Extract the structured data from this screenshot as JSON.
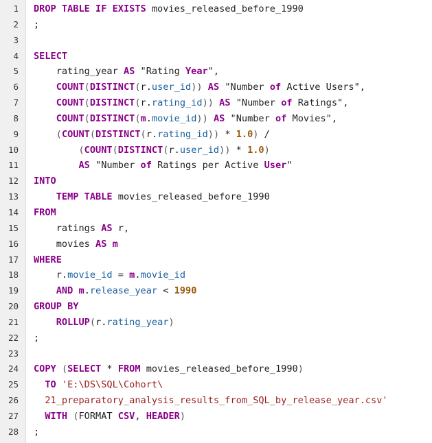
{
  "editor": {
    "lines": [
      [
        {
          "t": "k",
          "v": "DROP TABLE IF EXISTS"
        },
        {
          "t": "s",
          "v": " movies_released_before_1990"
        }
      ],
      [
        {
          "t": "s",
          "v": ";"
        }
      ],
      [],
      [
        {
          "t": "k",
          "v": "SELECT"
        }
      ],
      [
        {
          "t": "s",
          "v": "    rating_year "
        },
        {
          "t": "k",
          "v": "AS"
        },
        {
          "t": "s",
          "v": " \"Rating "
        },
        {
          "t": "k",
          "v": "Year"
        },
        {
          "t": "s",
          "v": "\","
        }
      ],
      [
        {
          "t": "s",
          "v": "    "
        },
        {
          "t": "k",
          "v": "COUNT"
        },
        {
          "t": "p",
          "v": "("
        },
        {
          "t": "k",
          "v": "DISTINCT"
        },
        {
          "t": "p",
          "v": "("
        },
        {
          "t": "s",
          "v": "r."
        },
        {
          "t": "id",
          "v": "user_id"
        },
        {
          "t": "p",
          "v": "))"
        },
        {
          "t": "s",
          "v": " "
        },
        {
          "t": "k",
          "v": "AS"
        },
        {
          "t": "s",
          "v": " \"Number "
        },
        {
          "t": "k",
          "v": "of"
        },
        {
          "t": "s",
          "v": " Active Users\","
        }
      ],
      [
        {
          "t": "s",
          "v": "    "
        },
        {
          "t": "k",
          "v": "COUNT"
        },
        {
          "t": "p",
          "v": "("
        },
        {
          "t": "k",
          "v": "DISTINCT"
        },
        {
          "t": "p",
          "v": "("
        },
        {
          "t": "s",
          "v": "r."
        },
        {
          "t": "id",
          "v": "rating_id"
        },
        {
          "t": "p",
          "v": "))"
        },
        {
          "t": "s",
          "v": " "
        },
        {
          "t": "k",
          "v": "AS"
        },
        {
          "t": "s",
          "v": " \"Number "
        },
        {
          "t": "k",
          "v": "of"
        },
        {
          "t": "s",
          "v": " Ratings\","
        }
      ],
      [
        {
          "t": "s",
          "v": "    "
        },
        {
          "t": "k",
          "v": "COUNT"
        },
        {
          "t": "p",
          "v": "("
        },
        {
          "t": "k",
          "v": "DISTINCT"
        },
        {
          "t": "p",
          "v": "("
        },
        {
          "t": "k",
          "v": "m"
        },
        {
          "t": "s",
          "v": "."
        },
        {
          "t": "id",
          "v": "movie_id"
        },
        {
          "t": "p",
          "v": "))"
        },
        {
          "t": "s",
          "v": " "
        },
        {
          "t": "k",
          "v": "AS"
        },
        {
          "t": "s",
          "v": " \"Number "
        },
        {
          "t": "k",
          "v": "of"
        },
        {
          "t": "s",
          "v": " Movies\","
        }
      ],
      [
        {
          "t": "s",
          "v": "    "
        },
        {
          "t": "p",
          "v": "("
        },
        {
          "t": "k",
          "v": "COUNT"
        },
        {
          "t": "p",
          "v": "("
        },
        {
          "t": "k",
          "v": "DISTINCT"
        },
        {
          "t": "p",
          "v": "("
        },
        {
          "t": "s",
          "v": "r."
        },
        {
          "t": "id",
          "v": "rating_id"
        },
        {
          "t": "p",
          "v": "))"
        },
        {
          "t": "s",
          "v": " * "
        },
        {
          "t": "n",
          "v": "1.0"
        },
        {
          "t": "p",
          "v": ")"
        },
        {
          "t": "s",
          "v": " /"
        }
      ],
      [
        {
          "t": "s",
          "v": "        "
        },
        {
          "t": "p",
          "v": "("
        },
        {
          "t": "k",
          "v": "COUNT"
        },
        {
          "t": "p",
          "v": "("
        },
        {
          "t": "k",
          "v": "DISTINCT"
        },
        {
          "t": "p",
          "v": "("
        },
        {
          "t": "s",
          "v": "r."
        },
        {
          "t": "id",
          "v": "user_id"
        },
        {
          "t": "p",
          "v": "))"
        },
        {
          "t": "s",
          "v": " * "
        },
        {
          "t": "n",
          "v": "1.0"
        },
        {
          "t": "p",
          "v": ")"
        }
      ],
      [
        {
          "t": "s",
          "v": "        "
        },
        {
          "t": "k",
          "v": "AS"
        },
        {
          "t": "s",
          "v": " \"Number "
        },
        {
          "t": "k",
          "v": "of"
        },
        {
          "t": "s",
          "v": " Ratings per Active "
        },
        {
          "t": "k",
          "v": "User"
        },
        {
          "t": "s",
          "v": "\""
        }
      ],
      [
        {
          "t": "k",
          "v": "INTO"
        }
      ],
      [
        {
          "t": "s",
          "v": "    "
        },
        {
          "t": "k",
          "v": "TEMP TABLE"
        },
        {
          "t": "s",
          "v": " movies_released_before_1990"
        }
      ],
      [
        {
          "t": "k",
          "v": "FROM"
        }
      ],
      [
        {
          "t": "s",
          "v": "    ratings "
        },
        {
          "t": "k",
          "v": "AS"
        },
        {
          "t": "s",
          "v": " r,"
        }
      ],
      [
        {
          "t": "s",
          "v": "    movies "
        },
        {
          "t": "k",
          "v": "AS"
        },
        {
          "t": "s",
          "v": " "
        },
        {
          "t": "k",
          "v": "m"
        }
      ],
      [
        {
          "t": "k",
          "v": "WHERE"
        }
      ],
      [
        {
          "t": "s",
          "v": "    r."
        },
        {
          "t": "id",
          "v": "movie_id"
        },
        {
          "t": "s",
          "v": " = "
        },
        {
          "t": "k",
          "v": "m"
        },
        {
          "t": "s",
          "v": "."
        },
        {
          "t": "id",
          "v": "movie_id"
        }
      ],
      [
        {
          "t": "s",
          "v": "    "
        },
        {
          "t": "k",
          "v": "AND"
        },
        {
          "t": "s",
          "v": " "
        },
        {
          "t": "k",
          "v": "m"
        },
        {
          "t": "s",
          "v": "."
        },
        {
          "t": "id",
          "v": "release_year"
        },
        {
          "t": "s",
          "v": " < "
        },
        {
          "t": "n",
          "v": "1990"
        }
      ],
      [
        {
          "t": "k",
          "v": "GROUP BY"
        }
      ],
      [
        {
          "t": "s",
          "v": "    "
        },
        {
          "t": "k",
          "v": "ROLLUP"
        },
        {
          "t": "p",
          "v": "("
        },
        {
          "t": "s",
          "v": "r."
        },
        {
          "t": "id",
          "v": "rating_year"
        },
        {
          "t": "p",
          "v": ")"
        }
      ],
      [
        {
          "t": "s",
          "v": ";"
        }
      ],
      [],
      [
        {
          "t": "k",
          "v": "COPY"
        },
        {
          "t": "s",
          "v": " "
        },
        {
          "t": "p",
          "v": "("
        },
        {
          "t": "k",
          "v": "SELECT"
        },
        {
          "t": "s",
          "v": " * "
        },
        {
          "t": "k",
          "v": "FROM"
        },
        {
          "t": "s",
          "v": " movies_released_before_1990"
        },
        {
          "t": "p",
          "v": ")"
        }
      ],
      [
        {
          "t": "s",
          "v": "  "
        },
        {
          "t": "k",
          "v": "TO"
        },
        {
          "t": "s",
          "v": " "
        },
        {
          "t": "str",
          "v": "'E:\\DS\\SQL\\Cohort\\"
        }
      ],
      [
        {
          "t": "s",
          "v": "  "
        },
        {
          "t": "str",
          "v": "21_preparatory_analysis_results_from_SQL_by_release_year.csv'"
        }
      ],
      [
        {
          "t": "s",
          "v": "  "
        },
        {
          "t": "k",
          "v": "WITH"
        },
        {
          "t": "s",
          "v": " "
        },
        {
          "t": "p",
          "v": "("
        },
        {
          "t": "s",
          "v": "FORMAT "
        },
        {
          "t": "k",
          "v": "CSV"
        },
        {
          "t": "s",
          "v": ", "
        },
        {
          "t": "k",
          "v": "HEADER"
        },
        {
          "t": "p",
          "v": ")"
        }
      ],
      [
        {
          "t": "s",
          "v": ";"
        }
      ]
    ]
  }
}
